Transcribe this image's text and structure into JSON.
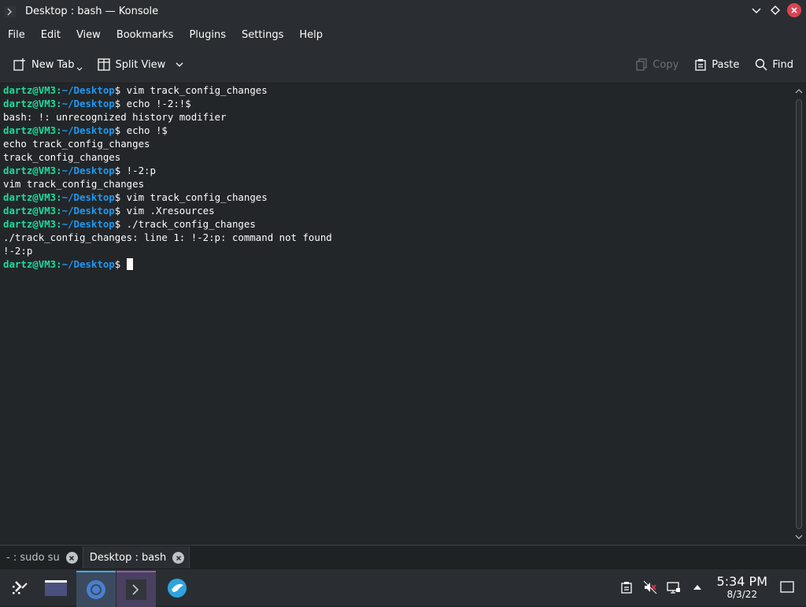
{
  "window": {
    "title": "Desktop : bash — Konsole"
  },
  "menubar": {
    "items": [
      "File",
      "Edit",
      "View",
      "Bookmarks",
      "Plugins",
      "Settings",
      "Help"
    ]
  },
  "toolbar": {
    "new_tab": "New Tab",
    "split_view": "Split View",
    "copy": "Copy",
    "paste": "Paste",
    "find": "Find"
  },
  "terminal": {
    "prompt_user": "dartz@VM3",
    "prompt_path": "~/Desktop",
    "lines": [
      {
        "type": "cmd",
        "text": "vim track_config_changes"
      },
      {
        "type": "cmd",
        "text": "echo !-2:!$"
      },
      {
        "type": "out",
        "text": "bash: !: unrecognized history modifier"
      },
      {
        "type": "cmd",
        "text": "echo !$"
      },
      {
        "type": "out",
        "text": "echo track_config_changes"
      },
      {
        "type": "out",
        "text": "track_config_changes"
      },
      {
        "type": "cmd",
        "text": "!-2:p"
      },
      {
        "type": "out",
        "text": "vim track_config_changes"
      },
      {
        "type": "cmd",
        "text": "vim track_config_changes"
      },
      {
        "type": "cmd",
        "text": "vim .Xresources"
      },
      {
        "type": "cmd",
        "text": "./track_config_changes"
      },
      {
        "type": "out",
        "text": "./track_config_changes: line 1: !-2:p: command not found"
      },
      {
        "type": "out",
        "text": "!-2:p"
      },
      {
        "type": "cmd",
        "text": ""
      }
    ]
  },
  "tabs": [
    {
      "label": "- : sudo su",
      "active": false
    },
    {
      "label": "Desktop : bash",
      "active": true
    }
  ],
  "taskbar": {
    "time": "5:34 PM",
    "date": "8/3/22"
  },
  "colors": {
    "prompt_user": "#1cdc9a",
    "prompt_path": "#1d99f3",
    "close_button": "#da4453",
    "accent": "#3daee9"
  }
}
